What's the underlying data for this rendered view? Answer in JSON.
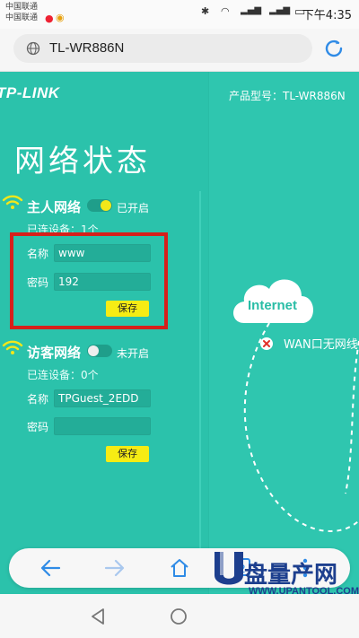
{
  "status_bar": {
    "carrier_1": "中国联通",
    "carrier_2": "中国联通",
    "time": "下午4:35"
  },
  "browser": {
    "url": "TL-WR886N"
  },
  "header": {
    "brand": "TP-LINK",
    "model_label": "产品型号：TL-WR886N"
  },
  "page_title": "网络状态",
  "main_network": {
    "title": "主人网络",
    "toggle_state": "已开启",
    "connected": "已连设备：1个",
    "name_label": "名称",
    "name_value": "www",
    "password_label": "密码",
    "password_value": "192",
    "save_label": "保存"
  },
  "guest_network": {
    "title": "访客网络",
    "toggle_state": "未开启",
    "connected": "已连设备：0个",
    "name_label": "名称",
    "name_value": "TPGuest_2EDD",
    "password_label": "密码",
    "password_value": "",
    "save_label": "保存"
  },
  "diagram": {
    "cloud_label": "Internet",
    "wan_status": "WAN口无网线"
  },
  "toolbar": {
    "tab_count": "2"
  },
  "watermark": {
    "text": "盘量产网",
    "url": "WWW.UPANTOOL.COM"
  },
  "colors": {
    "accent": "#29bda6",
    "save_button": "#f6ec14",
    "highlight_box": "#d6201b"
  }
}
